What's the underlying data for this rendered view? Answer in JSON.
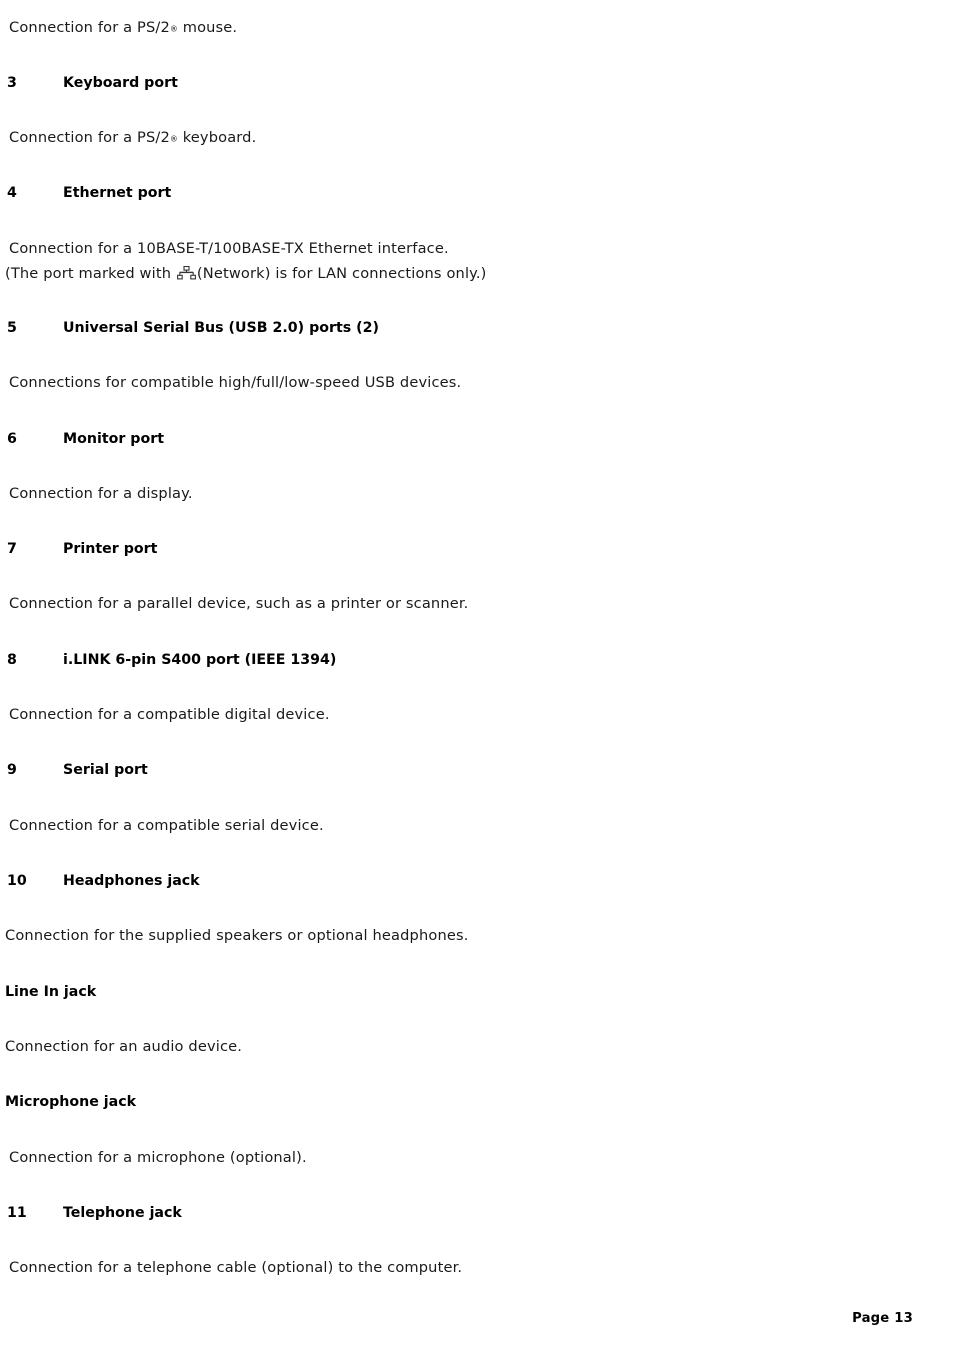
{
  "document": {
    "page_label": "Page 13",
    "background_color": "#ffffff",
    "text_color": "#000000"
  },
  "intro": {
    "text_before": "Connection for a PS/2",
    "registered_mark": "®",
    "text_after": " mouse."
  },
  "entries": [
    {
      "number": "3",
      "label": "Keyboard port",
      "lines": [
        {
          "text_before": "Connection for a PS/2",
          "registered_mark": "®",
          "text_after": " keyboard.",
          "indent": true
        }
      ]
    },
    {
      "number": "4",
      "label": "Ethernet port",
      "lines": [
        {
          "text": "Connection for a 10BASE-T/100BASE-TX Ethernet interface.",
          "indent": true
        },
        {
          "text_before": "(The port marked with ",
          "icon": "network-icon",
          "text_after": "(Network) is for LAN connections only.)",
          "indent": false
        }
      ]
    },
    {
      "number": "5",
      "label": "Universal Serial Bus (USB 2.0) ports (2)",
      "lines": [
        {
          "text": "Connections for compatible high/full/low-speed USB devices.",
          "indent": true
        }
      ]
    },
    {
      "number": "6",
      "label": "Monitor port",
      "lines": [
        {
          "text": "Connection for a display.",
          "indent": true
        }
      ]
    },
    {
      "number": "7",
      "label": "Printer port",
      "lines": [
        {
          "text": "Connection for a parallel device, such as a printer or scanner.",
          "indent": true
        }
      ]
    },
    {
      "number": "8",
      "label": "i.LINK 6-pin S400 port (IEEE 1394)",
      "lines": [
        {
          "text": "Connection for a compatible digital device.",
          "indent": true
        }
      ]
    },
    {
      "number": "9",
      "label": "Serial port",
      "lines": [
        {
          "text": "Connection for a compatible serial device.",
          "indent": true
        }
      ]
    },
    {
      "number": "10",
      "label": "Headphones jack",
      "lines": [
        {
          "text": "Connection for the supplied speakers or optional headphones.",
          "indent": false
        }
      ]
    },
    {
      "number": "",
      "label": "Line In jack",
      "lines": [
        {
          "text": "Connection for an audio device.",
          "indent": false
        }
      ]
    },
    {
      "number": "",
      "label": "Microphone jack",
      "lines": [
        {
          "text": "Connection for a microphone (optional).",
          "indent": true
        }
      ]
    },
    {
      "number": "11",
      "label": "Telephone jack",
      "lines": [
        {
          "text": "Connection for a telephone cable (optional) to the computer.",
          "indent": true
        }
      ]
    }
  ]
}
